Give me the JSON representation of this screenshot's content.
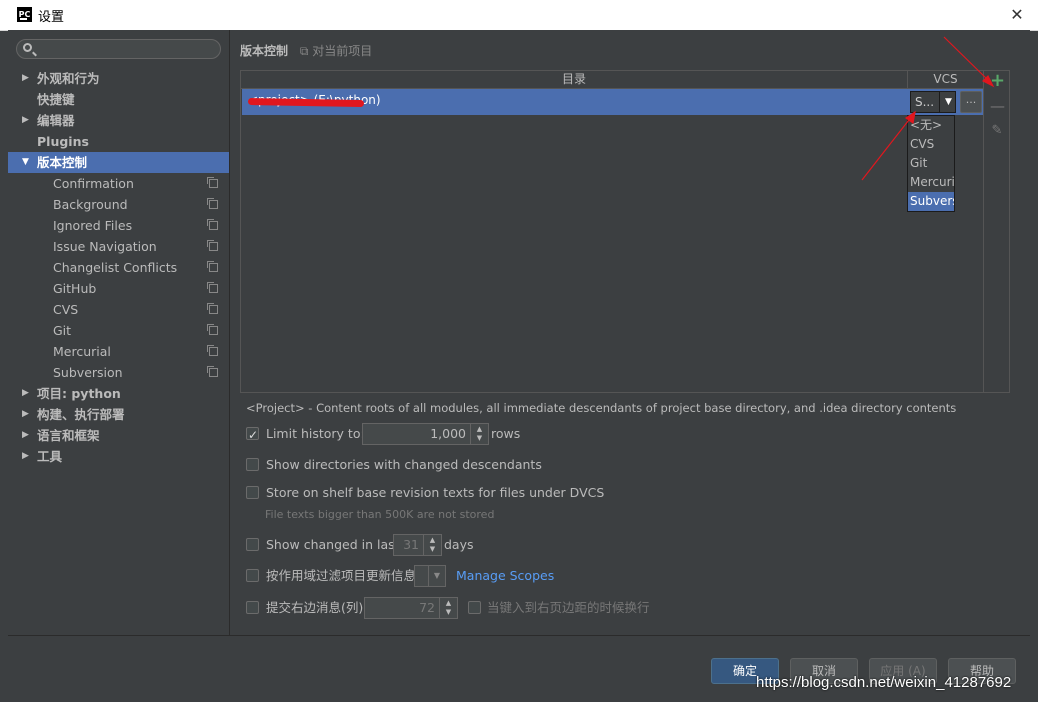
{
  "window": {
    "title": "设置",
    "app_logo": "PC",
    "close_glyph": "✕"
  },
  "search": {
    "placeholder": ""
  },
  "sidebar": {
    "items": [
      {
        "label": "外观和行为",
        "arrow": "▶",
        "bold": true
      },
      {
        "label": "快捷键",
        "arrow": "",
        "bold": true
      },
      {
        "label": "编辑器",
        "arrow": "▶",
        "bold": true
      },
      {
        "label": "Plugins",
        "arrow": "",
        "bold": true
      },
      {
        "label": "版本控制",
        "arrow": "▼",
        "bold": true,
        "selected": true
      },
      {
        "label": "Confirmation",
        "child": true
      },
      {
        "label": "Background",
        "child": true
      },
      {
        "label": "Ignored Files",
        "child": true
      },
      {
        "label": "Issue Navigation",
        "child": true
      },
      {
        "label": "Changelist Conflicts",
        "child": true
      },
      {
        "label": "GitHub",
        "child": true
      },
      {
        "label": "CVS",
        "child": true
      },
      {
        "label": "Git",
        "child": true
      },
      {
        "label": "Mercurial",
        "child": true
      },
      {
        "label": "Subversion",
        "child": true
      },
      {
        "label": "项目: python",
        "arrow": "▶",
        "bold": true
      },
      {
        "label": "构建、执行部署",
        "arrow": "▶",
        "bold": true
      },
      {
        "label": "语言和框架",
        "arrow": "▶",
        "bold": true
      },
      {
        "label": "工具",
        "arrow": "▶",
        "bold": true
      }
    ]
  },
  "breadcrumb": {
    "title": "版本控制",
    "scope": "对当前项目"
  },
  "table": {
    "col_directory": "目录",
    "col_vcs": "VCS",
    "row_path": "<project> (E:\\python)",
    "vcs_value": "S...",
    "vcs_arrow": "▼",
    "more_label": "...",
    "add_glyph": "+",
    "remove_glyph": "—",
    "edit_glyph": "✎"
  },
  "vcs_options": [
    "<无>",
    "CVS",
    "Git",
    "Mercurial",
    "Subversion"
  ],
  "vcs_selected_index": 4,
  "note": "<Project> - Content roots of all modules, all immediate descendants of project base directory, and .idea directory contents",
  "options": {
    "limit_history": {
      "label": "Limit history to:",
      "value": "1,000",
      "suffix": "rows",
      "checked": true
    },
    "show_dirs": {
      "label": "Show directories with changed descendants",
      "checked": false
    },
    "store_shelf": {
      "label": "Store on shelf base revision texts for files under DVCS",
      "hint": "File texts bigger than 500K are not stored",
      "checked": false
    },
    "show_changed": {
      "label": "Show changed in last",
      "value": "31",
      "suffix": "days",
      "checked": false
    },
    "filter_scope": {
      "label": "按作用域过滤项目更新信息",
      "link": "Manage Scopes",
      "checked": false
    },
    "commit_margin": {
      "label": "提交右边消息(列):",
      "value": "72",
      "wrap_label": "当键入到右页边距的时候换行",
      "checked": false
    }
  },
  "buttons": {
    "ok": "确定",
    "cancel": "取消",
    "apply": "应用 (A)",
    "help": "帮助"
  },
  "watermark": "https://blog.csdn.net/weixin_41287692",
  "colors": {
    "selection": "#4b6eaf",
    "background": "#3c3f41",
    "accent_add": "#59a869",
    "annotation": "#e1171e",
    "link": "#589df6"
  }
}
